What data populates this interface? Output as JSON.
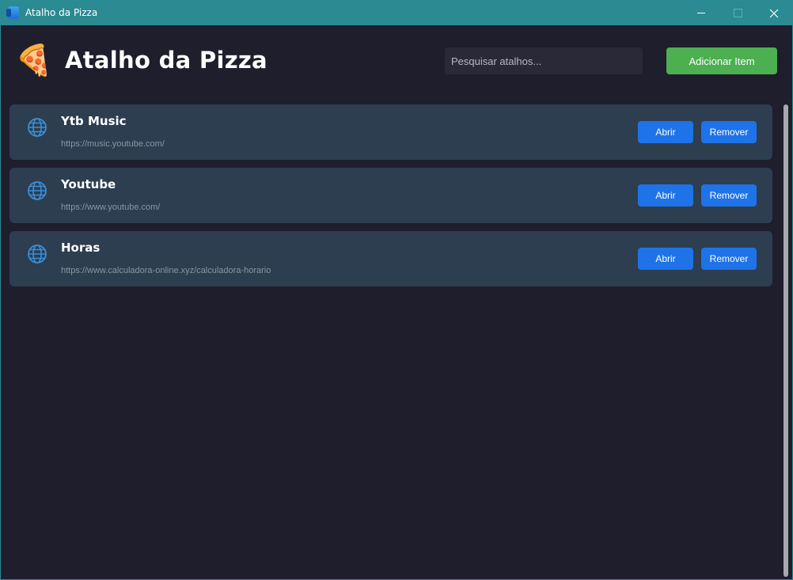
{
  "window": {
    "title": "Atalho da Pizza",
    "controls": {
      "minimize": "minimize-icon",
      "maximize": "maximize-icon",
      "close": "close-icon"
    }
  },
  "header": {
    "logo_icon": "🍕",
    "title": "Atalho da Pizza",
    "search_placeholder": "Pesquisar atalhos...",
    "add_button": "Adicionar Item"
  },
  "items": [
    {
      "name": "Ytb Music",
      "url": "https://music.youtube.com/",
      "open_label": "Abrir",
      "remove_label": "Remover",
      "icon": "globe-icon"
    },
    {
      "name": "Youtube",
      "url": "https://www.youtube.com/",
      "open_label": "Abrir",
      "remove_label": "Remover",
      "icon": "globe-icon"
    },
    {
      "name": "Horas",
      "url": "https://www.calculadora-online.xyz/calculadora-horario",
      "open_label": "Abrir",
      "remove_label": "Remover",
      "icon": "globe-icon"
    }
  ],
  "colors": {
    "titlebar": "#2b8a92",
    "background": "#1f1e2d",
    "card": "#2c3e50",
    "primary_button": "#1f73e8",
    "add_button": "#4caf50",
    "globe": "#3a8fd9"
  }
}
